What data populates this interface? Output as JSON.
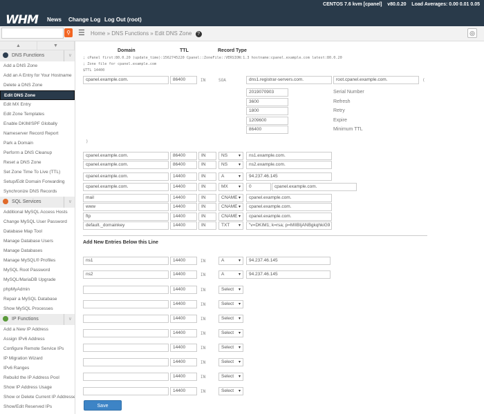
{
  "header": {
    "logo": "WHM",
    "nav": [
      "News",
      "Change Log",
      "Log Out (root)"
    ],
    "sysinfo": "CENTOS 7.6 kvm [cpanel]    v80.0.20    Load Averages: 0.00 0.01 0.05"
  },
  "breadcrumb": {
    "home": "Home",
    "sep": "»",
    "section": "DNS Functions",
    "page": "Edit DNS Zone",
    "help": "?"
  },
  "sidebar": {
    "sections": [
      {
        "title": "DNS Functions",
        "icon_color": "#2d3e50",
        "items": [
          "Add a DNS Zone",
          "Add an A Entry for Your Hostname",
          "Delete a DNS Zone",
          "Edit DNS Zone",
          "Edit MX Entry",
          "Edit Zone Templates",
          "Enable DKIM/SPF Globally",
          "Nameserver Record Report",
          "Park a Domain",
          "Perform a DNS Cleanup",
          "Reset a DNS Zone",
          "Set Zone Time To Live (TTL)",
          "Setup/Edit Domain Forwarding",
          "Synchronize DNS Records"
        ]
      },
      {
        "title": "SQL Services",
        "icon_color": "#e06a2a",
        "items": [
          "Additional MySQL Access Hosts",
          "Change MySQL User Password",
          "Database Map Tool",
          "Manage Database Users",
          "Manage Databases",
          "Manage MySQL® Profiles",
          "MySQL Root Password",
          "MySQL/MariaDB Upgrade",
          "phpMyAdmin",
          "Repair a MySQL Database",
          "Show MySQL Processes"
        ]
      },
      {
        "title": "IP Functions",
        "icon_color": "#5a9a3a",
        "items": [
          "Add a New IP Address",
          "Assign IPv6 Address",
          "Configure Remote Service IPs",
          "IP Migration Wizard",
          "IPv6 Ranges",
          "Rebuild the IP Address Pool",
          "Show IP Address Usage",
          "Show or Delete Current IP Addresses",
          "Show/Edit Reserved IPs"
        ]
      }
    ],
    "active": "Edit DNS Zone"
  },
  "table": {
    "headers": {
      "domain": "Domain",
      "ttl": "TTL",
      "type": "Record Type"
    }
  },
  "comments": [
    "; cPanel first:80.0.20 (update_time):1562745220 Cpanel::ZoneFile::VERSION:1.3 hostname:cpanel.example.com latest:80.0.20",
    "; Zone file for cpanel.example.com",
    "$TTL 14400"
  ],
  "soa": {
    "domain": "cpanel.example.com.",
    "ttl": "86400",
    "class": "IN",
    "type": "SOA",
    "mname": "dns1.registrar-servers.com.",
    "rname": "root.cpanel.example.com.",
    "open": "(",
    "close": ")",
    "fields": [
      {
        "value": "2019070903",
        "label": "Serial Number"
      },
      {
        "value": "3600",
        "label": "Refresh"
      },
      {
        "value": "1800",
        "label": "Retry"
      },
      {
        "value": "1209600",
        "label": "Expire"
      },
      {
        "value": "86400",
        "label": "Minimum TTL"
      }
    ]
  },
  "records": [
    {
      "domain": "cpanel.example.com.",
      "ttl": "86400",
      "class": "IN",
      "type": "NS",
      "data": "ns1.example.com."
    },
    {
      "domain": "cpanel.example.com.",
      "ttl": "86400",
      "class": "IN",
      "type": "NS",
      "data": "ns2.example.com."
    },
    {
      "domain": "cpanel.example.com.",
      "ttl": "14400",
      "class": "IN",
      "type": "A",
      "data": "94.237.46.145"
    },
    {
      "domain": "cpanel.example.com.",
      "ttl": "14400",
      "class": "IN",
      "type": "MX",
      "priority": "0",
      "data": "cpanel.example.com."
    },
    {
      "domain": "mail",
      "ttl": "14400",
      "class": "IN",
      "type": "CNAME",
      "data": "cpanel.example.com."
    },
    {
      "domain": "www",
      "ttl": "14400",
      "class": "IN",
      "type": "CNAME",
      "data": "cpanel.example.com."
    },
    {
      "domain": "ftp",
      "ttl": "14400",
      "class": "IN",
      "type": "CNAME",
      "data": "cpanel.example.com."
    },
    {
      "domain": "default._domainkey",
      "ttl": "14400",
      "class": "IN",
      "type": "TXT",
      "data": "\"v=DKIM1; k=rsa; p=MIIBIjANBgkqhkiG9"
    }
  ],
  "add_new_label": "Add New Entries Below this Line",
  "new_entries": [
    {
      "domain": "ns1",
      "ttl": "14400",
      "class": "IN",
      "type": "A",
      "data": "94.237.46.145"
    },
    {
      "domain": "ns2",
      "ttl": "14400",
      "class": "IN",
      "type": "A",
      "data": "94.237.46.145"
    },
    {
      "domain": "",
      "ttl": "14400",
      "class": "IN",
      "type": "Select",
      "data": null
    },
    {
      "domain": "",
      "ttl": "14400",
      "class": "IN",
      "type": "Select",
      "data": null
    },
    {
      "domain": "",
      "ttl": "14400",
      "class": "IN",
      "type": "Select",
      "data": null
    },
    {
      "domain": "",
      "ttl": "14400",
      "class": "IN",
      "type": "Select",
      "data": null
    },
    {
      "domain": "",
      "ttl": "14400",
      "class": "IN",
      "type": "Select",
      "data": null
    },
    {
      "domain": "",
      "ttl": "14400",
      "class": "IN",
      "type": "Select",
      "data": null
    },
    {
      "domain": "",
      "ttl": "14400",
      "class": "IN",
      "type": "Select",
      "data": null
    },
    {
      "domain": "",
      "ttl": "14400",
      "class": "IN",
      "type": "Select",
      "data": null
    }
  ],
  "save_label": "Save"
}
